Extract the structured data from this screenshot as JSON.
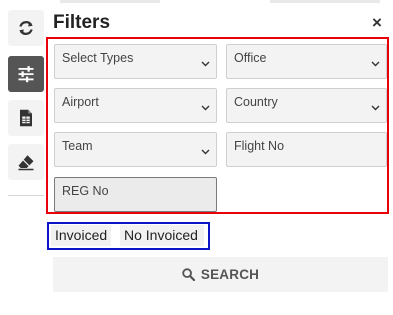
{
  "title": "Filters",
  "close_label": "×",
  "sidebar": {
    "buttons": [
      {
        "icon": "refresh-icon"
      },
      {
        "icon": "filter-sliders-icon",
        "active": true
      },
      {
        "icon": "spreadsheet-file-icon"
      },
      {
        "icon": "eraser-icon"
      }
    ]
  },
  "fields": {
    "types": {
      "label": "Select Types",
      "kind": "select"
    },
    "office": {
      "label": "Office",
      "kind": "select"
    },
    "airport": {
      "label": "Airport",
      "kind": "select"
    },
    "country": {
      "label": "Country",
      "kind": "select"
    },
    "team": {
      "label": "Team",
      "kind": "select"
    },
    "flight": {
      "label": "Flight No",
      "kind": "input"
    },
    "reg": {
      "label": "REG No",
      "kind": "input"
    }
  },
  "invoice_toggle": {
    "invoiced": "Invoiced",
    "no_invoiced": "No Invoiced"
  },
  "search": {
    "label": "SEARCH",
    "icon": "search-icon"
  },
  "colors": {
    "highlight_red": "#e8000b",
    "highlight_blue": "#0a15c7",
    "active_sidebar": "#555555"
  }
}
